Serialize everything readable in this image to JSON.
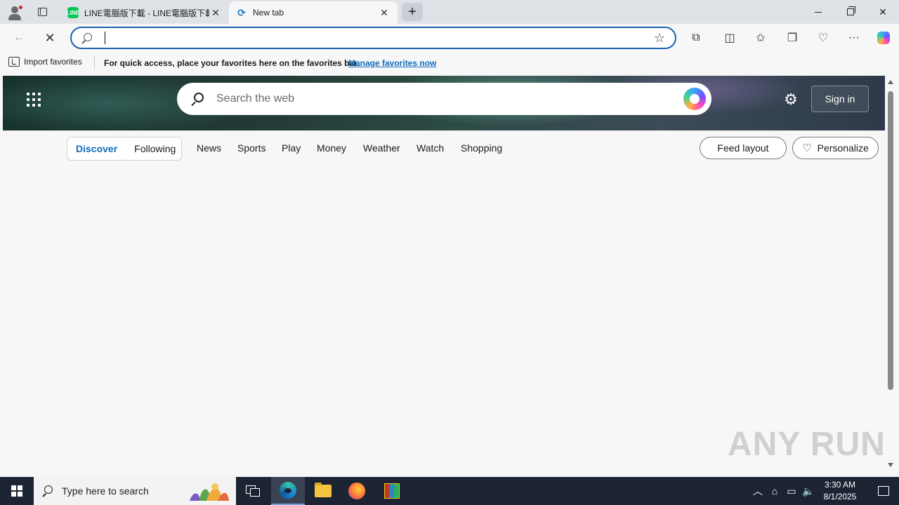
{
  "browser": {
    "tabs": [
      {
        "title": "LINE電腦版下載 - LINE電腦版下載",
        "favicon": "line-icon",
        "active": false
      },
      {
        "title": "New tab",
        "favicon": "edge-icon",
        "active": true
      }
    ],
    "address_bar": {
      "value": "",
      "placeholder": ""
    },
    "favorites_bar": {
      "import_label": "Import favorites",
      "message": "For quick access, place your favorites here on the favorites bar.",
      "manage_link": "Manage favorites now"
    }
  },
  "newtab": {
    "search_placeholder": "Search the web",
    "sign_in_label": "Sign in",
    "feed_tabs": [
      {
        "label": "Discover",
        "active": true
      },
      {
        "label": "Following",
        "active": false
      }
    ],
    "nav_items": [
      "News",
      "Sports",
      "Play",
      "Money",
      "Weather",
      "Watch",
      "Shopping"
    ],
    "feed_layout_label": "Feed layout",
    "personalize_label": "Personalize"
  },
  "watermark": "ANY RUN",
  "taskbar": {
    "search_placeholder": "Type here to search",
    "time": "3:30 AM",
    "date": "8/1/2025"
  },
  "colors": {
    "accent": "#0f6cbd",
    "address_border": "#1a5fb4",
    "taskbar": "#1c2433"
  }
}
